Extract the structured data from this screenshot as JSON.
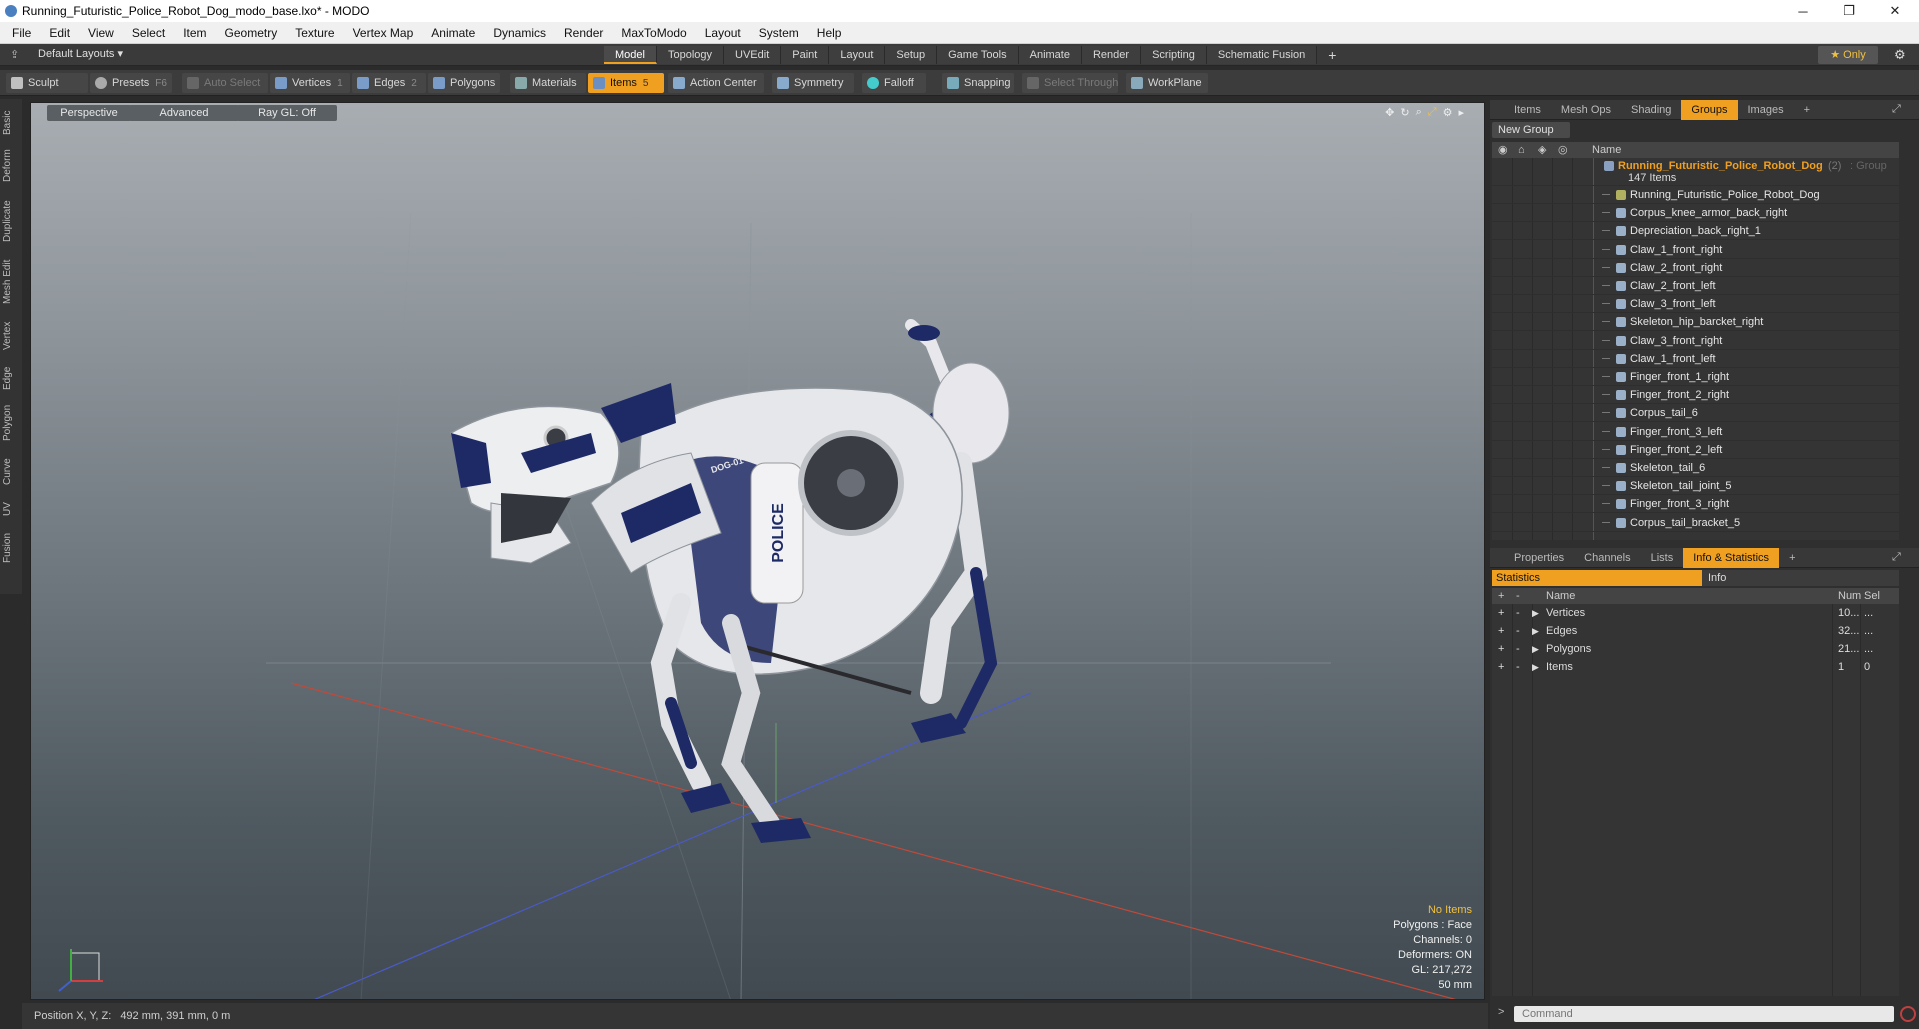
{
  "window": {
    "title": "Running_Futuristic_Police_Robot_Dog_modo_base.lxo* - MODO",
    "minimize": "─",
    "maximize": "❐",
    "close": "✕"
  },
  "menu": [
    "File",
    "Edit",
    "View",
    "Select",
    "Item",
    "Geometry",
    "Texture",
    "Vertex Map",
    "Animate",
    "Dynamics",
    "Render",
    "MaxToModo",
    "Layout",
    "System",
    "Help"
  ],
  "layout_selector": "Default Layouts ▾",
  "mode_tabs": [
    "Model",
    "Topology",
    "UVEdit",
    "Paint",
    "Layout",
    "Setup",
    "Game Tools",
    "Animate",
    "Render",
    "Scripting",
    "Schematic Fusion"
  ],
  "mode_tab_active": "Model",
  "only_button": "★ Only",
  "toolbar": {
    "sculpt": "Sculpt",
    "presets": "Presets",
    "presets_key": "F6",
    "auto_select": "Auto Select",
    "vertices": "Vertices",
    "vertices_key": "1",
    "edges": "Edges",
    "edges_key": "2",
    "polygons": "Polygons",
    "materials": "Materials",
    "items": "Items",
    "items_key": "5",
    "action_center": "Action Center",
    "symmetry": "Symmetry",
    "falloff": "Falloff",
    "snapping": "Snapping",
    "select_through": "Select Through",
    "workplane": "WorkPlane"
  },
  "left_tabs": [
    "Basic",
    "Deform",
    "Duplicate",
    "Mesh Edit",
    "Vertex",
    "Edge",
    "Polygon",
    "Curve",
    "UV",
    "Fusion"
  ],
  "viewport": {
    "perspective": "Perspective",
    "advanced": "Advanced",
    "raygl": "Ray GL: Off",
    "info": {
      "no_items": "No Items",
      "polygons": "Polygons : Face",
      "channels": "Channels: 0",
      "deformers": "Deformers: ON",
      "gl": "GL: 217,272",
      "scale": "50 mm"
    },
    "model_texts": {
      "police": "POLICE",
      "dog": "DOG-01"
    }
  },
  "status": {
    "position_label": "Position X, Y, Z:",
    "position_value": "492 mm, 391 mm, 0 m"
  },
  "groups_panel": {
    "tabs": [
      "Items",
      "Mesh Ops",
      "Shading",
      "Groups",
      "Images"
    ],
    "active_tab": "Groups",
    "new_group": "New Group",
    "column_name": "Name",
    "group": {
      "name": "Running_Futuristic_Police_Robot_Dog",
      "count": "(2)",
      "type": ": Group",
      "items": "147 Items"
    },
    "items": [
      "Running_Futuristic_Police_Robot_Dog",
      "Corpus_knee_armor_back_right",
      "Depreciation_back_right_1",
      "Claw_1_front_right",
      "Claw_2_front_right",
      "Claw_2_front_left",
      "Claw_3_front_left",
      "Skeleton_hip_barcket_right",
      "Claw_3_front_right",
      "Claw_1_front_left",
      "Finger_front_1_right",
      "Finger_front_2_right",
      "Corpus_tail_6",
      "Finger_front_3_left",
      "Finger_front_2_left",
      "Skeleton_tail_6",
      "Skeleton_tail_joint_5",
      "Finger_front_3_right",
      "Corpus_tail_bracket_5"
    ]
  },
  "info_panel": {
    "tabs": [
      "Properties",
      "Channels",
      "Lists",
      "Info & Statistics"
    ],
    "active_tab": "Info & Statistics",
    "subtabs": [
      "Statistics",
      "Info"
    ],
    "columns": {
      "name": "Name",
      "num": "Num",
      "sel": "Sel"
    },
    "rows": [
      {
        "name": "Vertices",
        "num": "10...",
        "sel": "..."
      },
      {
        "name": "Edges",
        "num": "32...",
        "sel": "..."
      },
      {
        "name": "Polygons",
        "num": "21...",
        "sel": "..."
      },
      {
        "name": "Items",
        "num": "1",
        "sel": "0"
      }
    ],
    "command_placeholder": "Command"
  },
  "colors": {
    "accent": "#f0a020",
    "group_name": "#f0a020",
    "robot_blue": "#1e2a66",
    "robot_white": "#e8e8ec"
  }
}
